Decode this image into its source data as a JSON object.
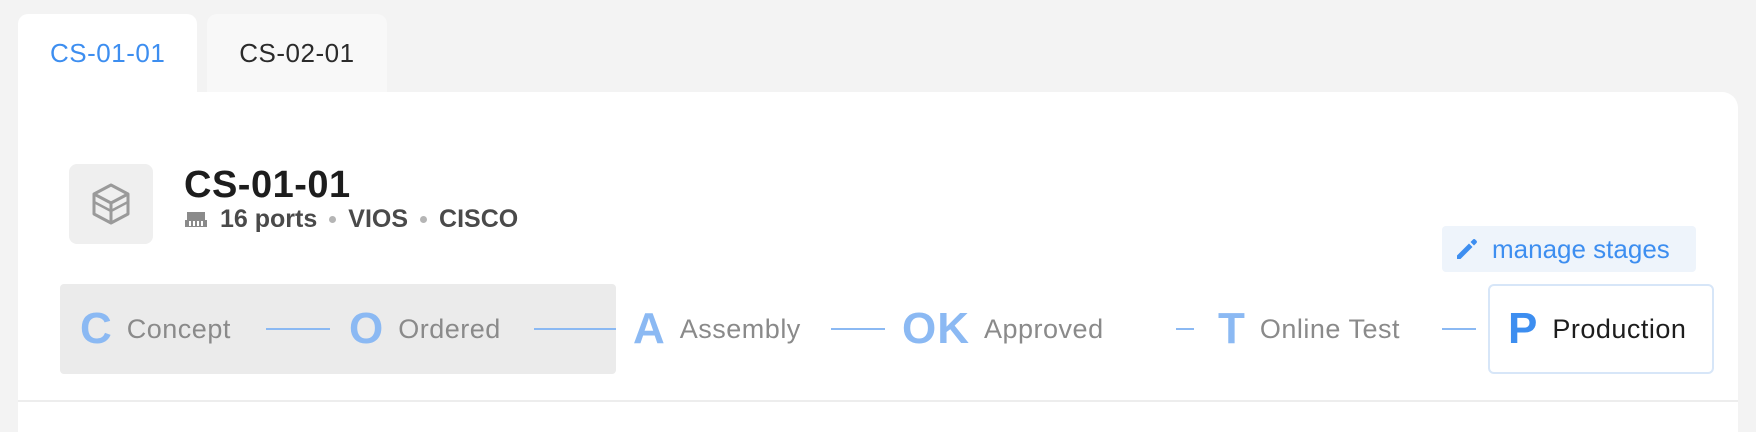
{
  "tabs": [
    {
      "label": "CS-01-01",
      "active": true
    },
    {
      "label": "CS-02-01",
      "active": false
    }
  ],
  "device": {
    "title": "CS-01-01",
    "icon": "cube-icon",
    "ports_icon": "ethernet-port-icon",
    "ports": "16 ports",
    "platform": "VIOS",
    "vendor": "CISCO"
  },
  "manage_stages": {
    "label": "manage stages",
    "icon": "pencil-icon"
  },
  "stages": [
    {
      "letter": "C",
      "label": "Concept"
    },
    {
      "letter": "O",
      "label": "Ordered"
    },
    {
      "letter": "A",
      "label": "Assembly"
    },
    {
      "letter": "OK",
      "label": "Approved"
    },
    {
      "letter": "T",
      "label": "Online Test"
    },
    {
      "letter": "P",
      "label": "Production",
      "current": true
    }
  ],
  "colors": {
    "accent": "#3d8ef0",
    "accent_light": "#8bb9f3",
    "muted_text": "#8a8a8a"
  }
}
